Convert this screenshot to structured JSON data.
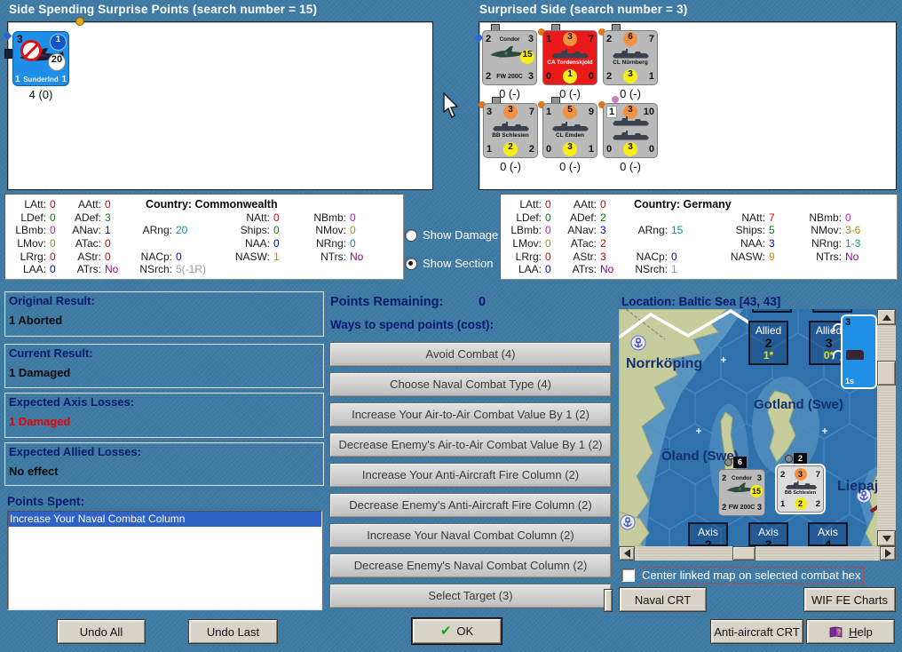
{
  "spending_panel": {
    "title": "Side Spending Surprise Points (search number = 15)",
    "unit": {
      "top_left": "3",
      "loop_badge": "1",
      "range": "20",
      "bottom_left": "1",
      "name": "Sunderlnd",
      "bottom_right": "1",
      "below": "4 (0)"
    }
  },
  "surprised_panel": {
    "title": "Surprised Side (search number = 3)",
    "units": [
      {
        "top_left": "2",
        "name": "Condor",
        "top_right": "3",
        "range": "15",
        "bottom_left": "2",
        "bottom_name": "FW 200C",
        "bottom_right": "3",
        "below": "0 (-)"
      },
      {
        "top_left": "1",
        "top_mid": "3",
        "top_right": "7",
        "name": "CA Tordenskjold",
        "bottom_left": "0",
        "bottom_mid": "1",
        "bottom_right": "0",
        "below": "0 (-)"
      },
      {
        "top_left": "2",
        "top_mid": "6",
        "top_right": "7",
        "name": "CL Nürnberg",
        "bottom_left": "2",
        "bottom_mid": "3",
        "bottom_right": "1",
        "below": "0 (-)"
      },
      {
        "top_left": "3",
        "top_mid": "3",
        "top_right": "7",
        "name": "BB Schlesien",
        "bottom_left": "1",
        "bottom_mid": "2",
        "bottom_right": "2",
        "below": "0 (-)"
      },
      {
        "top_left": "1",
        "top_mid": "5",
        "top_right": "9",
        "name": "CL Emden",
        "bottom_left": "0",
        "bottom_mid": "3",
        "bottom_right": "1",
        "below": "0 (-)"
      },
      {
        "top_left": "1",
        "top_mid": "3",
        "top_right": "10",
        "bottom_left": "0",
        "bottom_mid": "3",
        "bottom_right": "0",
        "below": "0 (-)"
      }
    ]
  },
  "stats_left": {
    "country": "Country: Commonwealth",
    "cells": [
      {
        "row": 1,
        "col": 1,
        "label": "LAtt:",
        "value": "0",
        "color": "#e00000"
      },
      {
        "row": 2,
        "col": 1,
        "label": "LDef:",
        "value": "0",
        "color": "#008000"
      },
      {
        "row": 3,
        "col": 1,
        "label": "LBmb:",
        "value": "0",
        "color": "#e000e0"
      },
      {
        "row": 4,
        "col": 1,
        "label": "LMov:",
        "value": "0",
        "color": "#999900"
      },
      {
        "row": 5,
        "col": 1,
        "label": "LRrg:",
        "value": "0",
        "color": "#e00000"
      },
      {
        "row": 6,
        "col": 1,
        "label": "LAA:",
        "value": "0",
        "color": "#0000e0"
      },
      {
        "row": 1,
        "col": 2,
        "label": "AAtt:",
        "value": "0",
        "color": "#e00000"
      },
      {
        "row": 2,
        "col": 2,
        "label": "ADef:",
        "value": "3",
        "color": "#008000"
      },
      {
        "row": 3,
        "col": 2,
        "label": "ANav:",
        "value": "1",
        "color": "#0000e0"
      },
      {
        "row": 4,
        "col": 2,
        "label": "ATac:",
        "value": "0",
        "color": "#e00000"
      },
      {
        "row": 5,
        "col": 2,
        "label": "AStr:",
        "value": "0",
        "color": "#e00000"
      },
      {
        "row": 6,
        "col": 2,
        "label": "ATrs:",
        "value": "No",
        "color": "#990099"
      },
      {
        "row": 3,
        "col": 3,
        "label": "ARng:",
        "value": "20",
        "color": "#009898"
      },
      {
        "row": 5,
        "col": 3,
        "label": "NACp:",
        "value": "0",
        "color": "#0000e0"
      },
      {
        "row": 6,
        "col": 3,
        "label": "NSrch:",
        "value": "5(-1R)",
        "color": "#9a9a9a"
      },
      {
        "row": 2,
        "col": 4,
        "label": "NAtt:",
        "value": "0",
        "color": "#e00000"
      },
      {
        "row": 3,
        "col": 4,
        "label": "Ships:",
        "value": "0",
        "color": "#008000"
      },
      {
        "row": 4,
        "col": 4,
        "label": "NAA:",
        "value": "0",
        "color": "#0000e0"
      },
      {
        "row": 5,
        "col": 4,
        "label": "NASW:",
        "value": "1",
        "color": "#e08000"
      },
      {
        "row": 2,
        "col": 5,
        "label": "NBmb:",
        "value": "0",
        "color": "#e000e0"
      },
      {
        "row": 3,
        "col": 5,
        "label": "NMov:",
        "value": "0",
        "color": "#999900"
      },
      {
        "row": 4,
        "col": 5,
        "label": "NRng:",
        "value": "0",
        "color": "#009898"
      },
      {
        "row": 5,
        "col": 5,
        "label": "NTrs:",
        "value": "No",
        "color": "#990099"
      }
    ]
  },
  "stats_right": {
    "country": "Country: Germany",
    "cells": [
      {
        "row": 1,
        "col": 1,
        "label": "LAtt:",
        "value": "0",
        "color": "#e00000"
      },
      {
        "row": 2,
        "col": 1,
        "label": "LDef:",
        "value": "0",
        "color": "#008000"
      },
      {
        "row": 3,
        "col": 1,
        "label": "LBmb:",
        "value": "0",
        "color": "#e000e0"
      },
      {
        "row": 4,
        "col": 1,
        "label": "LMov:",
        "value": "0",
        "color": "#999900"
      },
      {
        "row": 5,
        "col": 1,
        "label": "LRrg:",
        "value": "0",
        "color": "#e00000"
      },
      {
        "row": 6,
        "col": 1,
        "label": "LAA:",
        "value": "0",
        "color": "#0000e0"
      },
      {
        "row": 1,
        "col": 2,
        "label": "AAtt:",
        "value": "0",
        "color": "#e00000"
      },
      {
        "row": 2,
        "col": 2,
        "label": "ADef:",
        "value": "2",
        "color": "#008000"
      },
      {
        "row": 3,
        "col": 2,
        "label": "ANav:",
        "value": "3",
        "color": "#0000e0"
      },
      {
        "row": 4,
        "col": 2,
        "label": "ATac:",
        "value": "2",
        "color": "#e00000"
      },
      {
        "row": 5,
        "col": 2,
        "label": "AStr:",
        "value": "3",
        "color": "#e00000"
      },
      {
        "row": 6,
        "col": 2,
        "label": "ATrs:",
        "value": "No",
        "color": "#990099"
      },
      {
        "row": 3,
        "col": 3,
        "label": "ARng:",
        "value": "15",
        "color": "#009898"
      },
      {
        "row": 5,
        "col": 3,
        "label": "NACp:",
        "value": "0",
        "color": "#0000e0"
      },
      {
        "row": 6,
        "col": 3,
        "label": "NSrch:",
        "value": "1",
        "color": "#9a9a9a"
      },
      {
        "row": 2,
        "col": 4,
        "label": "NAtt:",
        "value": "7",
        "color": "#e00000"
      },
      {
        "row": 3,
        "col": 4,
        "label": "Ships:",
        "value": "5",
        "color": "#008000"
      },
      {
        "row": 4,
        "col": 4,
        "label": "NAA:",
        "value": "3",
        "color": "#0000e0"
      },
      {
        "row": 5,
        "col": 4,
        "label": "NASW:",
        "value": "9",
        "color": "#e08000"
      },
      {
        "row": 2,
        "col": 5,
        "label": "NBmb:",
        "value": "0",
        "color": "#e000e0"
      },
      {
        "row": 3,
        "col": 5,
        "label": "NMov:",
        "value": "3-6",
        "color": "#999900"
      },
      {
        "row": 4,
        "col": 5,
        "label": "NRng:",
        "value": "1-3",
        "color": "#009898"
      },
      {
        "row": 5,
        "col": 5,
        "label": "NTrs:",
        "value": "No",
        "color": "#990099"
      }
    ]
  },
  "view_radios": {
    "damage": "Show Damage",
    "section": "Show Section"
  },
  "results": [
    {
      "title": "Original Result:",
      "value": "1 Aborted",
      "color": "#0d0d0d"
    },
    {
      "title": "Current Result:",
      "value": "1 Damaged",
      "color": "#0d0d0d"
    },
    {
      "title": "Expected Axis Losses:",
      "value": "1 Damaged",
      "color": "#e80000"
    },
    {
      "title": "Expected Allied Losses:",
      "value": "No effect",
      "color": "#0d0d0d"
    }
  ],
  "points_spent": {
    "label": "Points Spent:",
    "items": [
      "Increase Your Naval Combat Column"
    ]
  },
  "actions": {
    "points_remaining_label": "Points Remaining:",
    "points_remaining_value": "0",
    "ways_label": "Ways to spend points (cost):",
    "buttons": [
      "Avoid Combat (4)",
      "Choose Naval Combat Type (4)",
      "Increase Your Air-to-Air Combat Value By 1 (2)",
      "Decrease Enemy's Air-to-Air Combat Value By 1 (2)",
      "Increase Your Anti-Aircraft Fire Column (2)",
      "Decrease Enemy's Anti-Aircraft Fire Column (2)",
      "Increase Your Naval Combat Column (2)",
      "Decrease Enemy's Naval Combat Column (2)",
      "Select Target (3)"
    ]
  },
  "map": {
    "title": "Location: Baltic Sea [43, 43]",
    "labels": {
      "norrkoping": "Norrköping",
      "gotland": "Gotland (Swe)",
      "oland": "Öland (Swe)",
      "liepaja": "Liepaj"
    },
    "stacks": [
      {
        "side": "Allied",
        "num": "2",
        "sub": "1*"
      },
      {
        "side": "Allied",
        "num": "3",
        "sub": "0*"
      },
      {
        "side": "Axis",
        "num": "2",
        "sub": ""
      },
      {
        "side": "Axis",
        "num": "3",
        "sub": ""
      },
      {
        "side": "Axis",
        "num": "4",
        "sub": ""
      }
    ],
    "condor_counter": {
      "badge": "6",
      "top_left": "2",
      "name": "Condor",
      "top_right": "3",
      "range": "15",
      "bottom_left": "2",
      "bottom_name": "FW 200C",
      "bottom_right": "3"
    },
    "schlesien_counter": {
      "badge": "2",
      "top_left": "2",
      "top_mid": "3",
      "top_right": "7",
      "name": "BB Schlesien",
      "bottom_left": "1",
      "bottom_mid": "2",
      "bottom_right": "2"
    },
    "edge_unit": {
      "top": "3",
      "bottom": "1s"
    },
    "checkbox_label": "Center linked map on selected combat hex"
  },
  "footer": {
    "undo_all": "Undo All",
    "undo_last": "Undo Last",
    "ok": "OK",
    "naval_crt": "Naval CRT",
    "wif_charts": "WIF FE Charts",
    "aa_crt": "Anti-aircraft CRT",
    "help": "Help"
  }
}
